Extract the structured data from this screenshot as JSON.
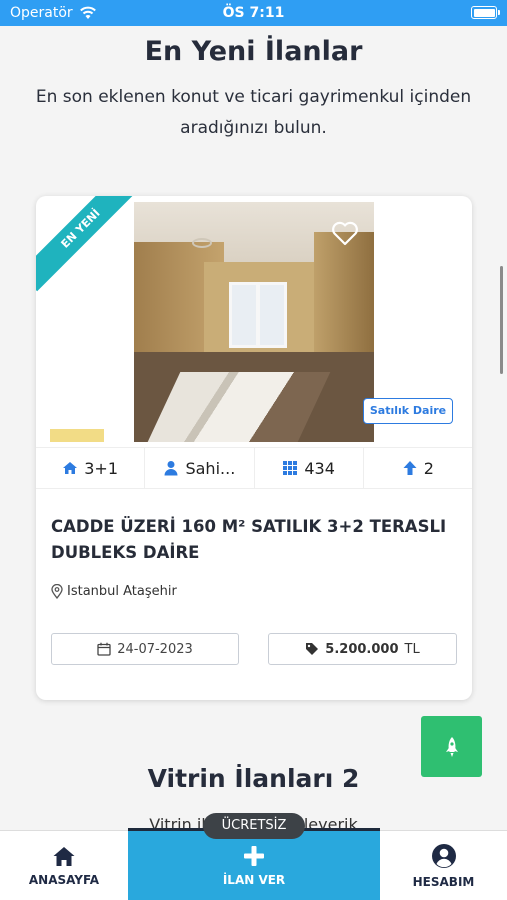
{
  "status_bar": {
    "carrier": "Operatör",
    "time": "ÖS 7:11"
  },
  "latest": {
    "title": "En Yeni İlanlar",
    "subtitle": "En son eklenen konut ve ticari gayrimenkul içinden aradığınızı bulun."
  },
  "listing": {
    "ribbon": "EN YENİ",
    "type_badge": "Satılık Daire",
    "features": {
      "rooms": "3+1",
      "owner": "Sahi...",
      "area": "434",
      "floor": "2"
    },
    "title": "CADDE ÜZERİ 160 M² SATILIK 3+2 TERASLI DUBLEKS DAİRE",
    "location": "Istanbul Ataşehir",
    "date": "24-07-2023",
    "price_amount": "5.200.000",
    "price_currency": "TL"
  },
  "showcase": {
    "title": "Vitrin İlanları 2",
    "subtitle": "Vitrin ilanlarını inceleyerik"
  },
  "tab_bar": {
    "home": "ANASAYFA",
    "post": "İLAN VER",
    "account": "HESABIM",
    "free_badge": "ÜCRETSİZ"
  },
  "colors": {
    "status_bar": "#2f9ef3",
    "accent_blue": "#2d7be0",
    "ribbon": "#1fb3be",
    "rocket": "#2fbf71",
    "post_tab": "#29a8dd"
  }
}
